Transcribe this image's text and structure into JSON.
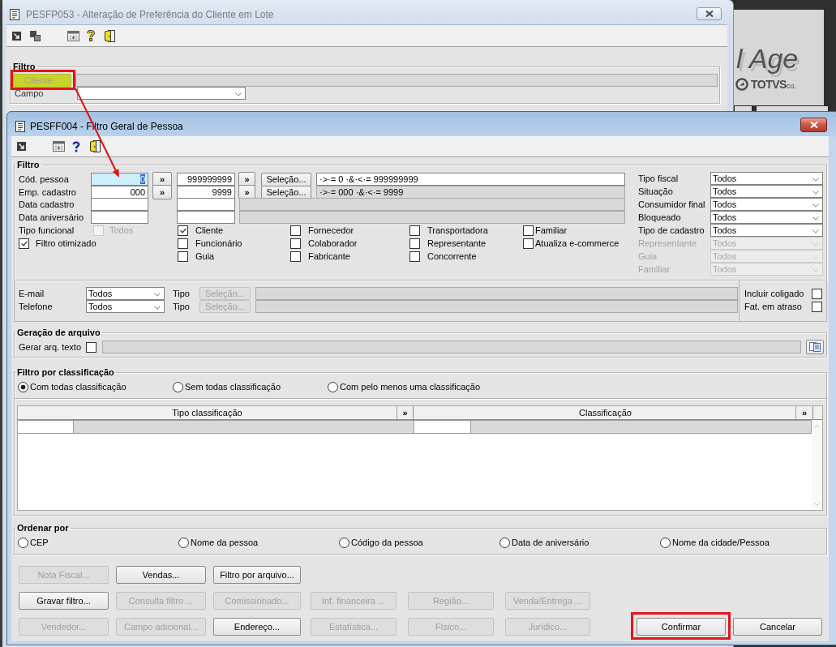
{
  "background_window": {
    "title": "PESFP053 - Alteração de Preferência do Cliente em Lote",
    "active": false,
    "filter": {
      "legend": "Filtro",
      "client_button": {
        "label": "Cliente...",
        "disabled": true,
        "highlighted": true,
        "marked": true
      },
      "field_label": "Campo"
    }
  },
  "desktop_logo": {
    "wordmark": "l Age",
    "brand": "TOTVS",
    "brand_suffix": "co."
  },
  "dialog": {
    "title": "PESFF004 - Filtro Geral de Pessoa",
    "active": true,
    "filter": {
      "legend": "Filtro",
      "ranges": [
        {
          "kind": "code",
          "label": "Cód. pessoa",
          "from": "0",
          "to": "999999999",
          "focused": true,
          "from_button": "»",
          "to_button": "»",
          "select_button": "Seleção...",
          "expression": {
            "text": "·>·= 0 ·&·<·= 999999999",
            "disabled": false
          }
        },
        {
          "kind": "code",
          "label": "Emp. cadastro",
          "from": "000",
          "to": "9999",
          "focused": false,
          "from_button": "»",
          "to_button": "»",
          "select_button": "Seleção...",
          "expression": {
            "text": "·>·= 000 ·&·<·= 9999",
            "disabled": true
          }
        },
        {
          "kind": "date",
          "label": "Data cadastro",
          "focused": false
        },
        {
          "kind": "date",
          "label": "Data aniversário",
          "focused": false
        }
      ],
      "functional_type": {
        "label": "Tipo funcional",
        "checked": false,
        "disabled": true,
        "option": "Todos"
      },
      "optimized": {
        "label": "Filtro otimizado",
        "checked": true
      },
      "person_types": [
        {
          "label": "Cliente",
          "checked": true
        },
        {
          "label": "Fornecedor",
          "checked": false
        },
        {
          "label": "Transportadora",
          "checked": false
        },
        {
          "label": "Familiar",
          "checked": false
        },
        {
          "label": "Funcionário",
          "checked": false
        },
        {
          "label": "Colaborador",
          "checked": false
        },
        {
          "label": "Representante",
          "checked": false
        },
        {
          "label": "Atualiza e-commerce",
          "checked": false
        },
        {
          "label": "Guia",
          "checked": false
        },
        {
          "label": "Fabricante",
          "checked": false
        },
        {
          "label": "Concorrente",
          "checked": false
        }
      ],
      "selects": [
        {
          "label": "Tipo fiscal",
          "value": "Todos",
          "disabled": false
        },
        {
          "label": "Situação",
          "value": "Todos",
          "disabled": false
        },
        {
          "label": "Consumidor final",
          "value": "Todos",
          "disabled": false
        },
        {
          "label": "Bloqueado",
          "value": "Todos",
          "disabled": false
        },
        {
          "label": "Tipo de cadastro",
          "value": "Todos",
          "disabled": false
        },
        {
          "label": "Representante",
          "value": "Todos",
          "disabled": true
        },
        {
          "label": "Guia",
          "value": "Todos",
          "disabled": true
        },
        {
          "label": "Familiar",
          "value": "Todos",
          "disabled": true
        }
      ]
    },
    "contacts": [
      {
        "label": "E-mail",
        "value": "Todos",
        "type_label": "Tipo",
        "button": "Seleção...",
        "disabled": true
      },
      {
        "label": "Telefone",
        "value": "Todos",
        "type_label": "Tipo",
        "button": "Seleção...",
        "disabled": true
      }
    ],
    "extra_options": [
      {
        "label": "Incluir coligado",
        "checked": false
      },
      {
        "label": "Fat. em atraso",
        "checked": false
      }
    ],
    "file_generation": {
      "legend": "Geração de arquivo",
      "label": "Gerar arq. texto",
      "checked": false
    },
    "classification": {
      "legend": "Filtro por classificação",
      "options": [
        {
          "label": "Com todas classificação",
          "selected": true
        },
        {
          "label": "Sem todas classificação",
          "selected": false
        },
        {
          "label": "Com pelo menos uma classificação",
          "selected": false
        }
      ],
      "columns": [
        {
          "title": "Tipo classificação",
          "button": "»"
        },
        {
          "title": "Classificação",
          "button": "»"
        }
      ]
    },
    "order_by": {
      "legend": "Ordenar por",
      "options": [
        {
          "label": "CEP",
          "selected": false
        },
        {
          "label": "Nome da pessoa",
          "selected": false
        },
        {
          "label": "Código da pessoa",
          "selected": false
        },
        {
          "label": "Data de aniversário",
          "selected": false
        },
        {
          "label": "Nome da cidade/Pessoa",
          "selected": false
        }
      ]
    },
    "button_rows": [
      [
        {
          "label": "Nota Fiscal...",
          "disabled": true
        },
        {
          "label": "Vendas...",
          "disabled": false
        },
        {
          "label": "Filtro por arquivo...",
          "disabled": false
        }
      ],
      [
        {
          "label": "Gravar filtro...",
          "disabled": false
        },
        {
          "label": "Consulta filtro ...",
          "disabled": true
        },
        {
          "label": "Comissionado...",
          "disabled": true
        },
        {
          "label": "Inf. financeira ...",
          "disabled": true
        },
        {
          "label": "Região...",
          "disabled": true
        },
        {
          "label": "Venda/Entrega ...",
          "disabled": true
        }
      ],
      [
        {
          "label": "Vendedor...",
          "disabled": true
        },
        {
          "label": "Campo adicional...",
          "disabled": true
        },
        {
          "label": "Endereço...",
          "disabled": false
        },
        {
          "label": "Estatística...",
          "disabled": true
        },
        {
          "label": "Físico...",
          "disabled": true
        },
        {
          "label": "Jurídico...",
          "disabled": true
        }
      ]
    ],
    "actions": [
      {
        "label": "Confirmar",
        "disabled": false,
        "marked": true
      },
      {
        "label": "Cancelar",
        "disabled": false,
        "marked": false
      }
    ]
  }
}
